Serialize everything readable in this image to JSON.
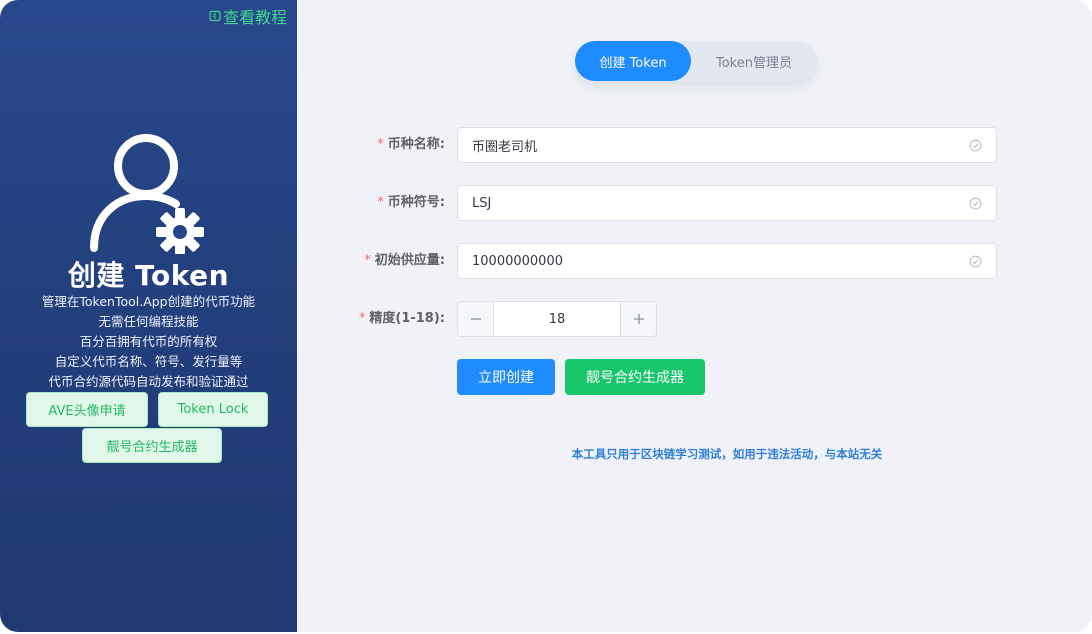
{
  "sidebar": {
    "tutorial_link": "查看教程",
    "hero_title": "创建 Token",
    "features": [
      "管理在TokenTool.App创建的代币功能",
      "无需任何编程技能",
      "百分百拥有代币的所有权",
      "自定义代币名称、符号、发行量等",
      "代币合约源代码自动发布和验证通过"
    ],
    "buttons": {
      "ave_avatar": "AVE头像申请",
      "token_lock": "Token Lock",
      "vanity_generator": "靓号合约生成器"
    }
  },
  "tabs": [
    {
      "label": "创建 Token",
      "active": true
    },
    {
      "label": "Token管理员",
      "active": false
    }
  ],
  "form": {
    "name": {
      "label": "币种名称:",
      "value": "币圈老司机"
    },
    "symbol": {
      "label": "币种符号:",
      "value": "LSJ"
    },
    "supply": {
      "label": "初始供应量:",
      "value": "10000000000"
    },
    "decimals": {
      "label": "精度(1-18):",
      "value": "18"
    }
  },
  "actions": {
    "create": "立即创建",
    "vanity_generator": "靓号合约生成器"
  },
  "disclaimer": "本工具只用于区块链学习测试，如用于违法活动，与本站无关",
  "colors": {
    "accent": "#1e8bff",
    "success": "#19c66a",
    "sidebar_top": "#28498c",
    "sidebar_bottom": "#1f3a70",
    "link_green": "#3fd68e",
    "required_star": "#f56c6c"
  }
}
